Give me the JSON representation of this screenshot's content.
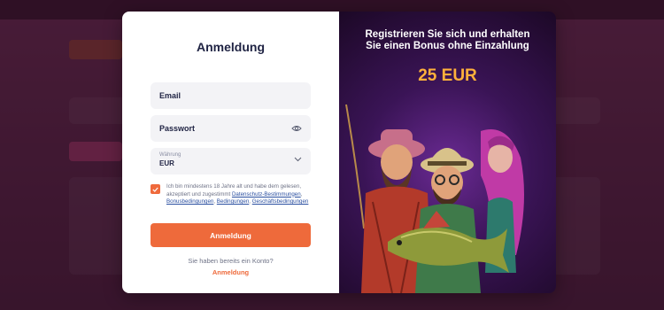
{
  "form": {
    "title": "Anmeldung",
    "email_label": "Email",
    "password_label": "Passwort",
    "currency_label": "Währung",
    "currency_value": "EUR",
    "terms_text": "Ich bin mindestens 18 Jahre alt und habe dem gelesen, akzeptiert und zugestimmt ",
    "terms_link_1": "Datenschutz-Bestimmungen",
    "terms_sep_1": ", ",
    "terms_link_2": "Bonusbedingungen",
    "terms_sep_2": ", ",
    "terms_link_3": "Bedingungen",
    "terms_sep_3": ", ",
    "terms_link_4": "Geschäftsbedingungen",
    "terms_checked": true,
    "submit_label": "Anmeldung",
    "have_account_text": "Sie haben bereits ein Konto?",
    "login_link_label": "Anmeldung"
  },
  "promo": {
    "title_line1": "Registrieren Sie sich und erhalten",
    "title_line2": "Sie einen Bonus ohne Einzahlung",
    "amount": "25 EUR"
  },
  "colors": {
    "accent": "#ee6a3b",
    "amount": "#ffb13b",
    "promo_bg": "#3a1456",
    "link": "#2a4fa0"
  },
  "icons": {
    "password_toggle": "eye-icon",
    "currency_dropdown": "chevron-down-icon",
    "checkbox": "check-icon"
  }
}
